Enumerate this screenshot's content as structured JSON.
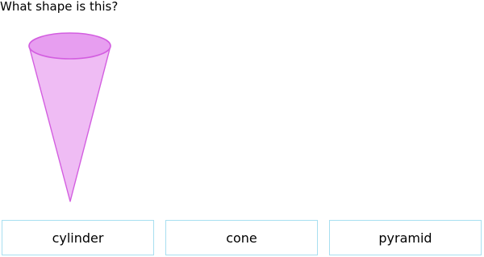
{
  "question": {
    "text": "What shape is this?"
  },
  "figure": {
    "shape_icon": "cone-icon",
    "fill_color": "#efbcf4",
    "top_color": "#e79ef0",
    "stroke_color": "#d35ee0"
  },
  "choices": [
    {
      "label": "cylinder"
    },
    {
      "label": "cone"
    },
    {
      "label": "pyramid"
    }
  ],
  "colors": {
    "choice_border": "#a8dff0"
  }
}
